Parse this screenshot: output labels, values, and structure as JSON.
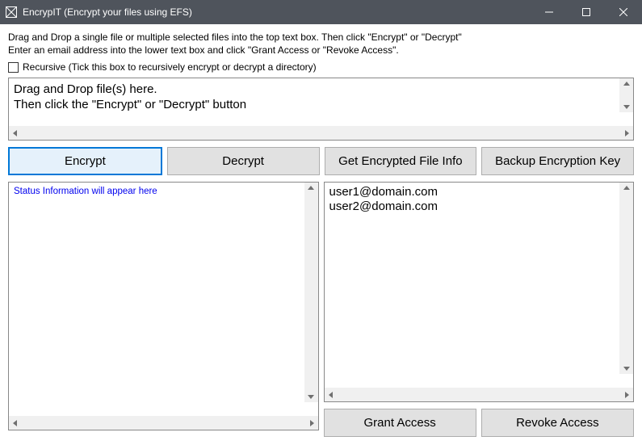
{
  "window": {
    "title": "EncrypIT (Encrypt your files using EFS)"
  },
  "instructions": {
    "line1": "Drag and Drop a single file or multiple selected files into the top text box. Then click \"Encrypt\" or \"Decrypt\"",
    "line2": "Enter an email address into the lower text box and click \"Grant Access or \"Revoke Access\"."
  },
  "recursive": {
    "label": "Recursive (Tick this box to recursively encrypt or decrypt a directory)",
    "checked": false
  },
  "dropArea": {
    "line1": "Drag and Drop file(s) here.",
    "line2": "Then click the \"Encrypt\" or \"Decrypt\" button"
  },
  "buttons": {
    "encrypt": "Encrypt",
    "decrypt": "Decrypt",
    "getInfo": "Get Encrypted File Info",
    "backupKey": "Backup Encryption Key",
    "grant": "Grant Access",
    "revoke": "Revoke Access"
  },
  "statusPanel": {
    "text": "Status Information will appear here"
  },
  "emailPanel": {
    "lines": "user1@domain.com\nuser2@domain.com"
  }
}
